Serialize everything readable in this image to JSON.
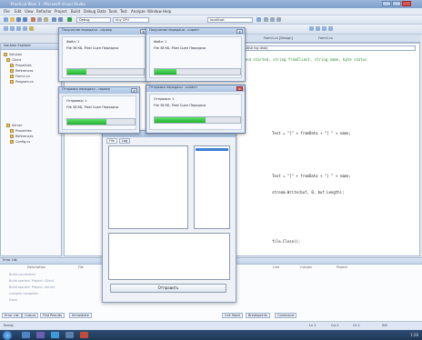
{
  "window": {
    "title": "Practical Work 3 - Microsoft Visual Studio"
  },
  "menu": [
    "File",
    "Edit",
    "View",
    "Refactor",
    "Project",
    "Build",
    "Debug",
    "Data",
    "Tools",
    "Test",
    "Analyze",
    "Window",
    "Help"
  ],
  "toolbar": {
    "config_combo": "Debug",
    "platform_combo": "Any CPU",
    "find_combo": "localhost"
  },
  "solution_explorer": {
    "title": "Solution Explorer",
    "items": [
      "Solution",
      "Client",
      "Properties",
      "References",
      "Form1.cs",
      "Program.cs",
      "Server",
      "Properties",
      "References",
      "Config.cs"
    ]
  },
  "editor": {
    "tabs": [
      "Server.cs",
      "Form1.cs [Design]",
      "Form1.cs"
    ],
    "context_combo": "Practical Work 3.Server",
    "member_combo": "Send(string data)",
    "lines": [
      {
        "text": "// File send started, string fromClient, string name, byte status",
        "kind": "comment"
      },
      {
        "text": "Text = \"[\" + fromData + \"] \" + name;",
        "kind": "code"
      },
      {
        "text": "Text = \"[\" + fromData + \"] \" + name;",
        "kind": "code"
      },
      {
        "text": "stream.Write(buf, 0, buf.Length);",
        "kind": "code"
      },
      {
        "text": "file.Close();",
        "kind": "code"
      }
    ]
  },
  "dialogs": [
    {
      "title": "Получение передачи - сервер",
      "line1": "Файл: 1",
      "line2": "File 38 КБ, Pixel Сцен Передача",
      "progress": 0.25,
      "close": "x"
    },
    {
      "title": "Получение передачи - клиент",
      "line1": "Файл: 1",
      "line2": "File 38 КБ, Pixel Сцен Передача",
      "progress": 0.25,
      "close": "x"
    },
    {
      "title": "Отправка передачи - сервер",
      "line1": "Отправка: 1",
      "line2": "File 38 КБ, Pixel Сцен Передача",
      "progress": 0.58,
      "close": "x"
    },
    {
      "title": "Отправка передачи - клиент",
      "line1": "Отправка: 1",
      "line2": "File 38 КБ, Pixel Сцен Передача",
      "progress": 0.6,
      "close": "x"
    }
  ],
  "main_form": {
    "title": "Form1",
    "tabs": [
      "File",
      "Log"
    ],
    "send_button": "Отправить"
  },
  "output": {
    "title": "Error List",
    "columns": [
      "",
      "Description",
      "File",
      "Line",
      "Column",
      "Project"
    ],
    "rows": [
      "Build succeeded",
      "Build started: Project: Client",
      "Build started: Project: Server",
      "Compile complete",
      "Done"
    ]
  },
  "bottom_tabs": [
    "Error List",
    "Output",
    "Find Results",
    "Immediate",
    "Call Stack",
    "Breakpoints",
    "Command"
  ],
  "status": {
    "text": "Ready",
    "ln": "Ln 1",
    "col": "Col 1",
    "ch": "Ch 1",
    "mode": "INS"
  },
  "tray": {
    "time": "1:28"
  },
  "colors": {
    "accent": "#3c7fd6",
    "progress": "#21b32e",
    "close_red": "#d9534f"
  }
}
